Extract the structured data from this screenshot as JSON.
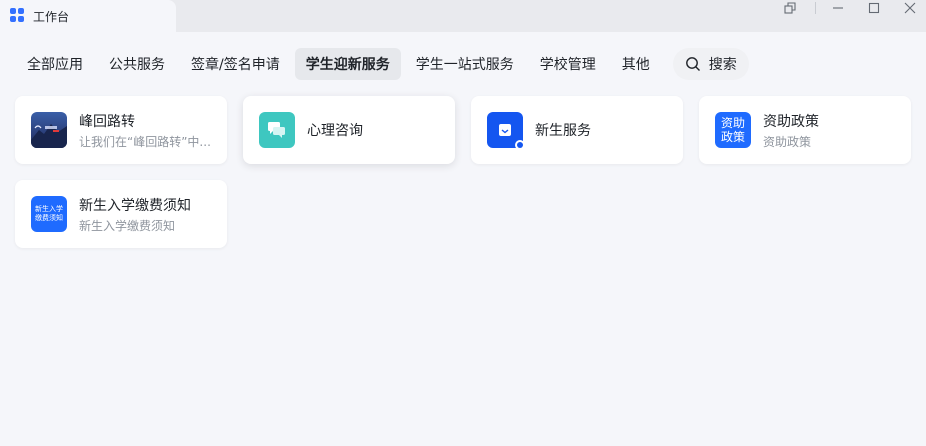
{
  "window": {
    "title": "工作台",
    "accent": "#3370ff"
  },
  "tabs": [
    {
      "label": "全部应用"
    },
    {
      "label": "公共服务"
    },
    {
      "label": "签章/签名申请"
    },
    {
      "label": "学生迎新服务",
      "active": true
    },
    {
      "label": "学生一站式服务"
    },
    {
      "label": "学校管理"
    },
    {
      "label": "其他"
    }
  ],
  "search": {
    "label": "搜索",
    "icon": "search-icon"
  },
  "apps": [
    {
      "title": "峰回路转",
      "subtitle": "让我们在“峰回路转”中...",
      "icon": "mountain-image-icon"
    },
    {
      "title": "心理咨询",
      "subtitle": "",
      "icon": "chat-bubbles-icon",
      "color": "#3ec7c0"
    },
    {
      "title": "新生服务",
      "subtitle": "",
      "icon": "inbox-icon",
      "color": "#1456f0"
    },
    {
      "title": "资助政策",
      "subtitle": "资助政策",
      "icon_text": "资助政策",
      "icon_line1": "资助",
      "icon_line2": "政策",
      "color": "#1f6bff"
    },
    {
      "title": "新生入学缴费须知",
      "subtitle": "新生入学缴费须知",
      "icon_line1": "新生入学",
      "icon_line2": "缴费须知",
      "color": "#1f6bff"
    }
  ]
}
